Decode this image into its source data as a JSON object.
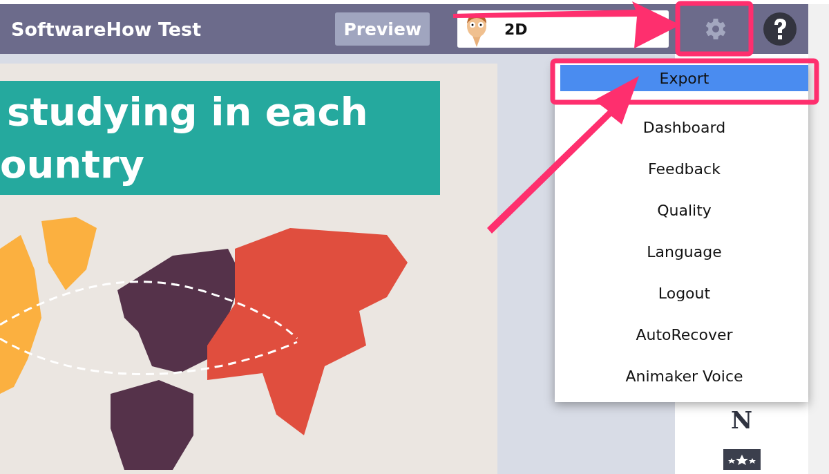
{
  "header": {
    "title": "SoftwareHow Test",
    "preview_button": "Preview",
    "character_selector": {
      "value": "2D"
    }
  },
  "slide": {
    "title_lines": [
      "studying in each",
      "ountry"
    ]
  },
  "side_panel": {
    "letter": "N"
  },
  "settings_menu": {
    "items": [
      {
        "label": "Export",
        "selected": true
      },
      {
        "label": "Dashboard",
        "selected": false
      },
      {
        "label": "Feedback",
        "selected": false
      },
      {
        "label": "Quality",
        "selected": false
      },
      {
        "label": "Language",
        "selected": false
      },
      {
        "label": "Logout",
        "selected": false
      },
      {
        "label": "AutoRecover",
        "selected": false
      },
      {
        "label": "Animaker Voice",
        "selected": false
      }
    ]
  }
}
